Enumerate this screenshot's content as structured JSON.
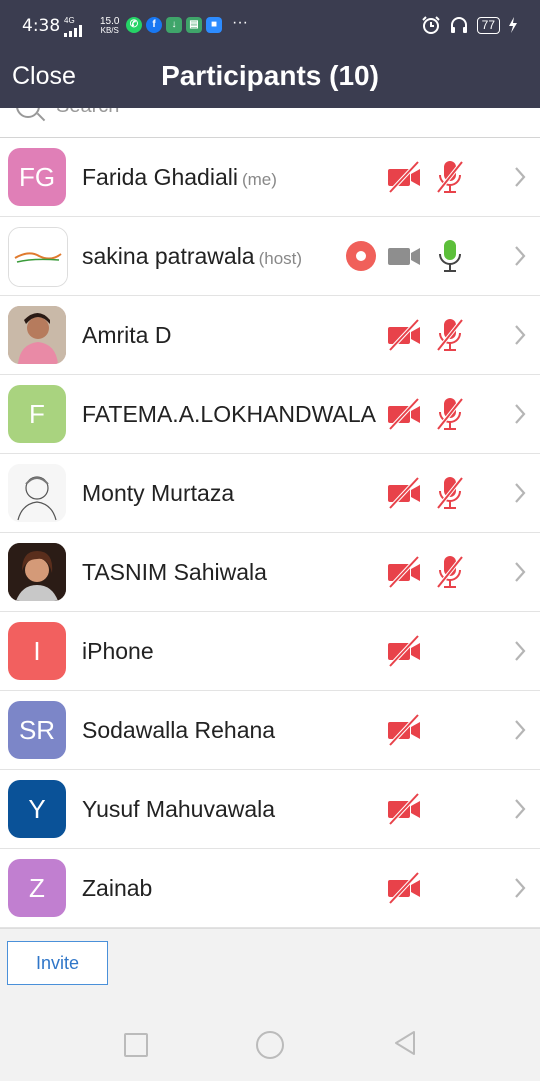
{
  "status_bar": {
    "time": "4:38",
    "network": "4G",
    "speed_value": "15.0",
    "speed_unit": "KB/S",
    "more": "···",
    "battery": "77"
  },
  "header": {
    "close_label": "Close",
    "title": "Participants (10)"
  },
  "search": {
    "placeholder": "Search"
  },
  "participants": [
    {
      "name": "Farida Ghadiali",
      "tag": "(me)",
      "initials": "FG",
      "avatar_color": "#e07fb7",
      "video": "off",
      "mic": "muted"
    },
    {
      "name": "sakina patrawala",
      "tag": "(host)",
      "initials": "",
      "avatar_color": "#ffffff",
      "video": "on",
      "mic": "on",
      "recording": true
    },
    {
      "name": "Amrita D",
      "tag": "",
      "initials": "",
      "avatar_color": "#b98a7a",
      "video": "off",
      "mic": "muted"
    },
    {
      "name": "FATEMA.A.LOKHANDWALA",
      "tag": "",
      "initials": "F",
      "avatar_color": "#a9d37f",
      "video": "off",
      "mic": "muted"
    },
    {
      "name": "Monty Murtaza",
      "tag": "",
      "initials": "",
      "avatar_color": "#f4f4f4",
      "video": "off",
      "mic": "muted"
    },
    {
      "name": "TASNIM Sahiwala",
      "tag": "",
      "initials": "",
      "avatar_color": "#3a2a22",
      "video": "off",
      "mic": "muted"
    },
    {
      "name": "iPhone",
      "tag": "",
      "initials": "I",
      "avatar_color": "#f2605f",
      "video": "off",
      "mic": "none"
    },
    {
      "name": "Sodawalla Rehana",
      "tag": "",
      "initials": "SR",
      "avatar_color": "#7c86c8",
      "video": "off",
      "mic": "none"
    },
    {
      "name": "Yusuf Mahuvawala",
      "tag": "",
      "initials": "Y",
      "avatar_color": "#0a5298",
      "video": "off",
      "mic": "none"
    },
    {
      "name": "Zainab",
      "tag": "",
      "initials": "Z",
      "avatar_color": "#c17fd0",
      "video": "off",
      "mic": "none"
    }
  ],
  "footer": {
    "invite_label": "Invite"
  },
  "colors": {
    "header_bg": "#3b3d50",
    "muted_red": "#e8424a",
    "mic_on_green": "#5cbf3a",
    "accent_blue": "#2f76c8"
  }
}
